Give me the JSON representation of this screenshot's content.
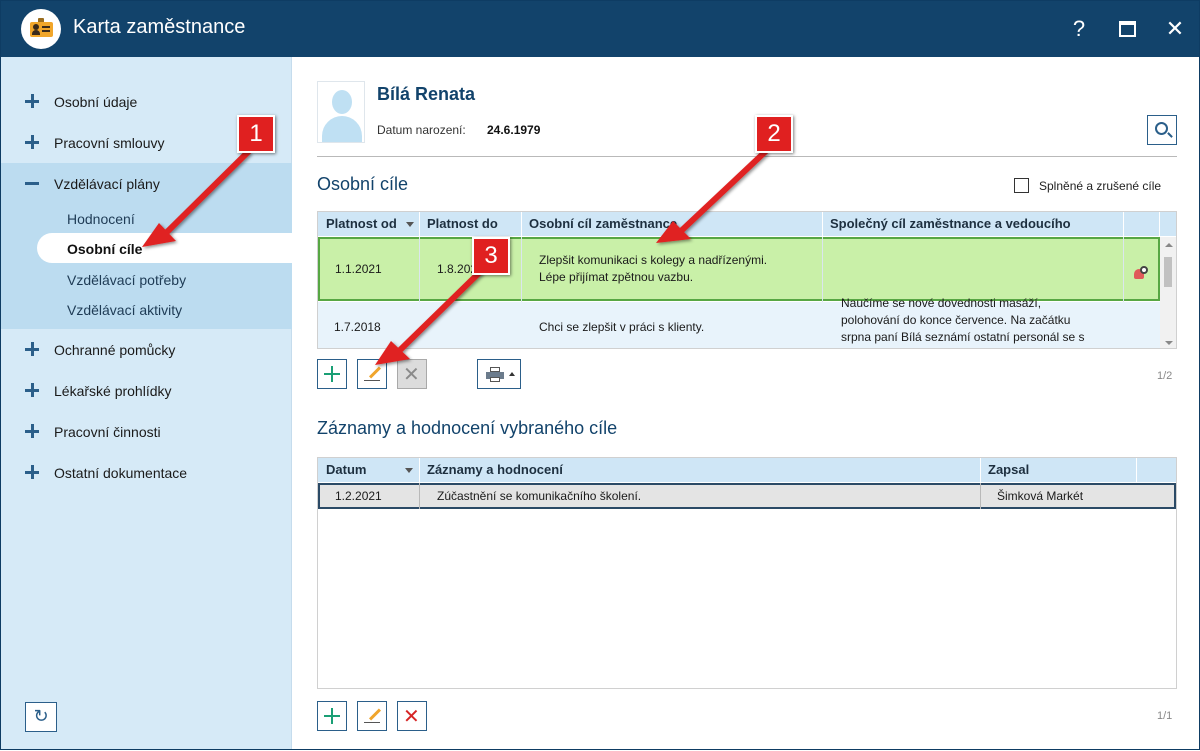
{
  "window": {
    "title": "Karta zaměstnance",
    "help_symbol": "?",
    "close_symbol": "✕"
  },
  "sidebar": {
    "items": [
      {
        "label": "Osobní údaje"
      },
      {
        "label": "Pracovní smlouvy"
      },
      {
        "label": "Vzdělávací plány"
      },
      {
        "label": "Ochranné pomůcky"
      },
      {
        "label": "Lékařské prohlídky"
      },
      {
        "label": "Pracovní činnosti"
      },
      {
        "label": "Ostatní dokumentace"
      }
    ],
    "subitems": [
      {
        "label": "Hodnocení"
      },
      {
        "label": "Osobní cíle"
      },
      {
        "label": "Vzdělávací potřeby"
      },
      {
        "label": "Vzdělávací aktivity"
      }
    ],
    "refresh_symbol": "↻"
  },
  "employee": {
    "name": "Bílá Renata",
    "dob_label": "Datum narození:",
    "dob_value": "24.6.1979"
  },
  "goals": {
    "title": "Osobní cíle",
    "checkbox_label": "Splněné a zrušené cíle",
    "columns": [
      "Platnost od",
      "Platnost do",
      "Osobní cíl zaměstnance",
      "Společný cíl zaměstnance a vedoucího"
    ],
    "rows": [
      {
        "from": "1.1.2021",
        "to": "1.8.2021",
        "personal_line1": "Zlepšit komunikaci s kolegy a nadřízenými.",
        "personal_line2": "Lépe přijímat zpětnou vazbu.",
        "shared_line1": "",
        "shared_line2": "",
        "shared_line3": ""
      },
      {
        "from": "1.7.2018",
        "to": "",
        "personal_line1": "Chci se zlepšit v práci s klienty.",
        "personal_line2": "",
        "shared_line1": "Naučíme se nové dovednosti masáží,",
        "shared_line2": "polohování do konce července. Na začátku",
        "shared_line3": "srpna paní Bílá seznámí ostatní personál se s"
      }
    ],
    "pager": "1/2"
  },
  "records": {
    "title": "Záznamy a hodnocení vybraného cíle",
    "columns": [
      "Datum",
      "Záznamy a hodnocení",
      "Zapsal"
    ],
    "rows": [
      {
        "date": "1.2.2021",
        "text": "Zúčastnění se komunikačního školení.",
        "author": "Šimková Markét"
      }
    ],
    "pager": "1/1"
  },
  "toolbar": {
    "delete_symbol": "✕"
  },
  "annotations": {
    "badge1": "1",
    "badge2": "2",
    "badge3": "3"
  },
  "colors": {
    "titlebar": "#12436b",
    "sidebar": "#d6eaf7",
    "selected_row": "#c9f0a8",
    "annotation": "#e02020"
  }
}
